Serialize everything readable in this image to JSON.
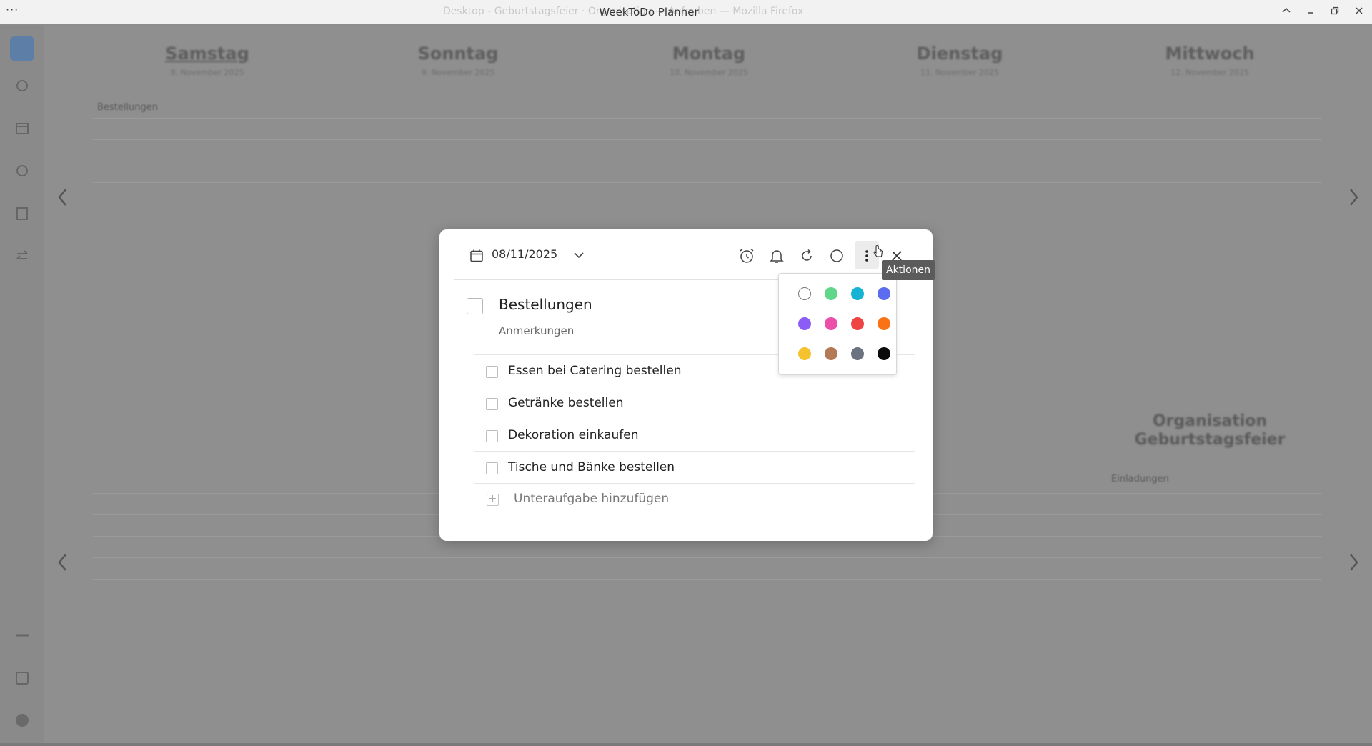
{
  "window": {
    "menu_label": "···",
    "title": "WeekToDo Planner",
    "background_title": "Desktop - Geburtstagsfeier · Organisation — Aufgaben — Mozilla Firefox"
  },
  "calendar": {
    "days": [
      {
        "name": "Samstag",
        "date": "8. November 2025"
      },
      {
        "name": "Sonntag",
        "date": "9. November 2025"
      },
      {
        "name": "Montag",
        "date": "10. November 2025"
      },
      {
        "name": "Dienstag",
        "date": "11. November 2025"
      },
      {
        "name": "Mittwoch",
        "date": "12. November 2025"
      }
    ],
    "saturday_task": "Bestellungen",
    "custom_list": {
      "title_line1": "Organisation",
      "title_line2": "Geburtstagsfeier",
      "task": "Einladungen"
    }
  },
  "modal": {
    "date": "08/11/2025",
    "task_title": "Bestellungen",
    "notes_placeholder": "Anmerkungen",
    "subtasks": [
      "Essen bei Catering bestellen",
      "Getränke bestellen",
      "Dekoration einkaufen",
      "Tische und Bänke bestellen"
    ],
    "add_subtask": "Unteraufgabe hinzufügen",
    "tooltip": "Aktionen"
  },
  "colors": {
    "swatches": [
      "none",
      "#5fd68a",
      "#16b3d4",
      "#5b6cf0",
      "#8b5cf6",
      "#ec4fa9",
      "#ef4444",
      "#f97316",
      "#f5c22f",
      "#b37a55",
      "#6b7280",
      "#0b0b0b"
    ]
  }
}
